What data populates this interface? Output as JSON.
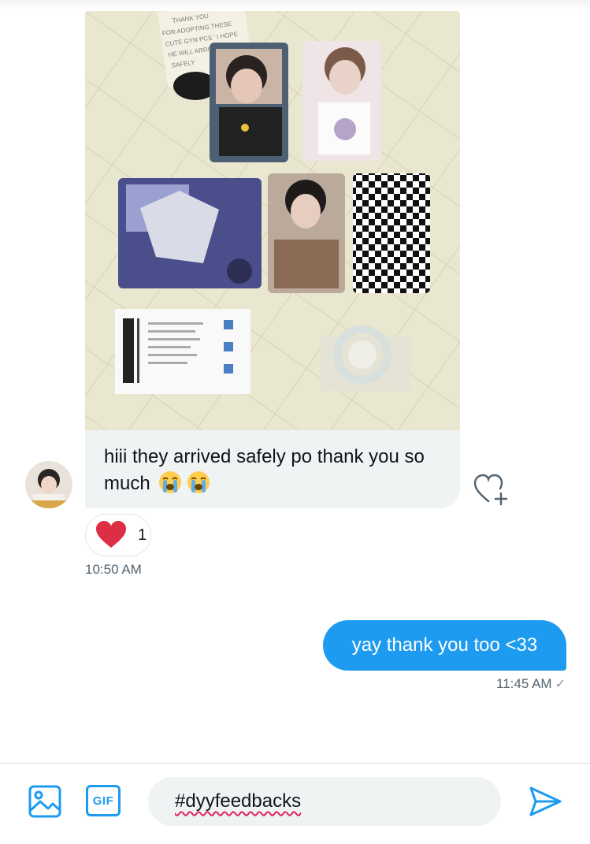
{
  "conversation": {
    "incoming": {
      "text": "hiii they arrived safely po thank you so much",
      "emojis": [
        "loudly-crying-face",
        "loudly-crying-face"
      ],
      "reaction": {
        "emoji": "heart",
        "count": "1"
      },
      "time": "10:50 AM"
    },
    "outgoing": {
      "text": "yay thank you too <33",
      "time": "11:45 AM",
      "status_icon": "check-icon"
    }
  },
  "composer": {
    "input_value": "#dyyfeedbacks",
    "gif_label": "GIF"
  },
  "colors": {
    "accent": "#1d9bf0",
    "bubble_in": "#eff3f4",
    "heart": "#f91880"
  }
}
